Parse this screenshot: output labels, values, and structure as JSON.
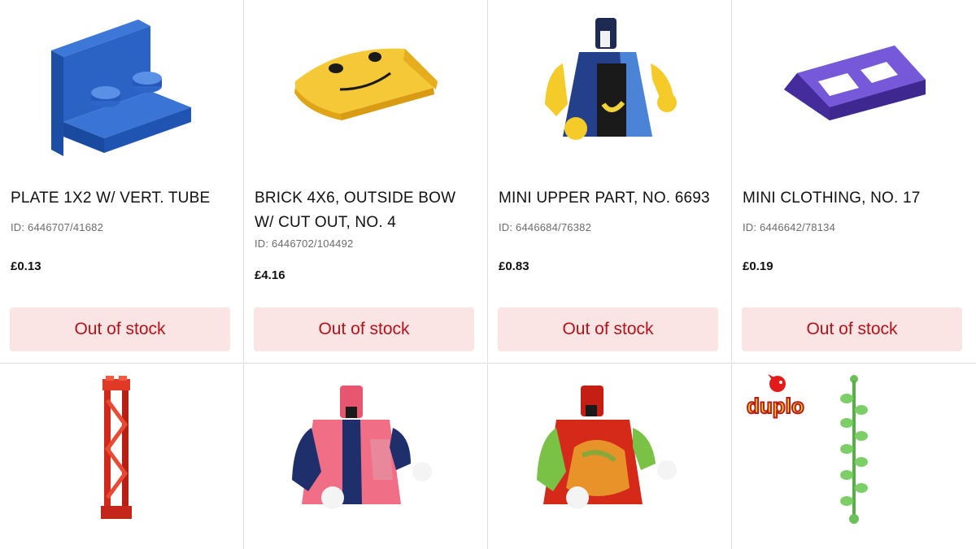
{
  "products_row1": [
    {
      "name": "PLATE 1X2 W/ VERT. TUBE",
      "id": "ID: 6446707/41682",
      "price": "£0.13",
      "stock": "Out of stock",
      "image": "blue-angle-plate-image"
    },
    {
      "name": "BRICK 4X6, OUTSIDE BOW W/ CUT OUT, NO. 4",
      "id": "ID: 6446702/104492",
      "price": "£4.16",
      "stock": "Out of stock",
      "image": "yellow-smiley-curved-brick-image"
    },
    {
      "name": "MINI UPPER PART, NO. 6693",
      "id": "ID: 6446684/76382",
      "price": "£0.83",
      "stock": "Out of stock",
      "image": "minifig-torso-banana-shirt-image"
    },
    {
      "name": "MINI CLOTHING, NO. 17",
      "id": "ID: 6446642/78134",
      "price": "£0.19",
      "stock": "Out of stock",
      "image": "purple-clothing-piece-image"
    }
  ],
  "products_row2": [
    {
      "image": "red-lattice-support-image"
    },
    {
      "image": "pink-jacket-torso-image"
    },
    {
      "image": "red-green-torso-image"
    },
    {
      "image": "green-vine-image",
      "badge": "duplo"
    }
  ],
  "colors": {
    "accent_red": "#b3121a",
    "stock_bg": "#fbe4e4",
    "divider": "#dedede"
  }
}
